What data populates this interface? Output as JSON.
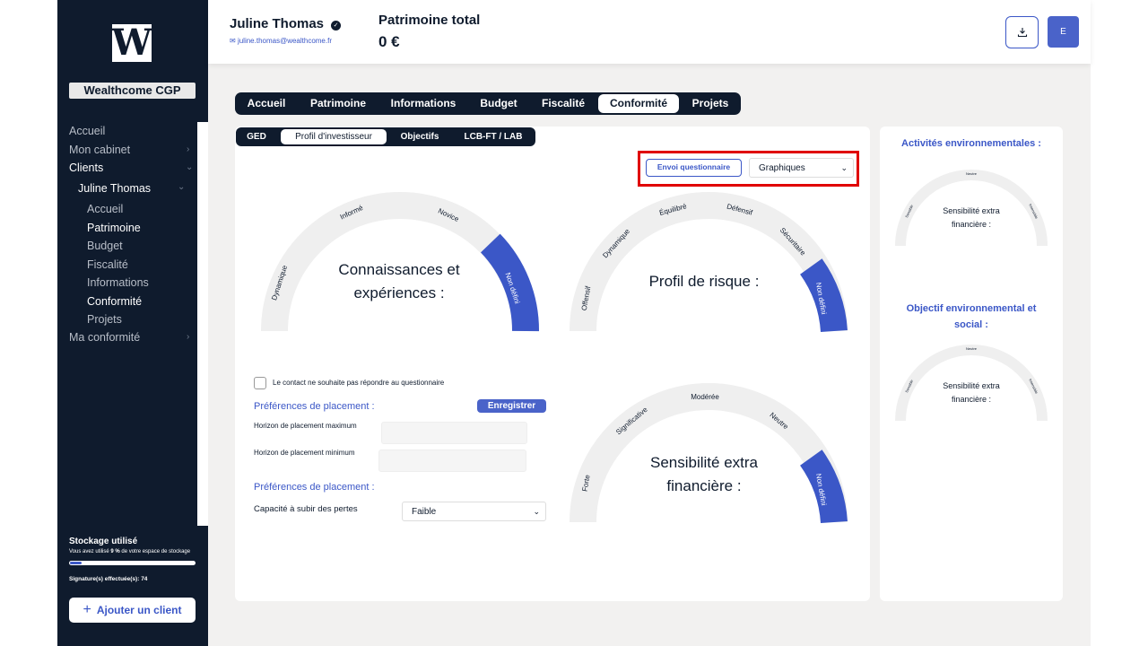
{
  "brand": {
    "logo_letter": "W",
    "name": "Wealthcome CGP"
  },
  "sidebar": {
    "items": [
      {
        "label": "Accueil"
      },
      {
        "label": "Mon cabinet"
      },
      {
        "label": "Clients"
      },
      {
        "label": "Juline Thomas"
      },
      {
        "label": "Accueil"
      },
      {
        "label": "Patrimoine"
      },
      {
        "label": "Budget"
      },
      {
        "label": "Fiscalité"
      },
      {
        "label": "Informations"
      },
      {
        "label": "Conformité"
      },
      {
        "label": "Projets"
      },
      {
        "label": "Ma conformité"
      }
    ],
    "storage_title": "Stockage utilisé",
    "storage_sub_pre": "Vous avez utilisé ",
    "storage_pct": "9 %",
    "storage_sub_post": " de votre espace de stockage",
    "storage_fraction": 0.09,
    "signatures_label": "Signature(s) effectuée(s): ",
    "signatures_count": "74",
    "add_client": "Ajouter un client"
  },
  "header": {
    "client_name": "Juline Thomas",
    "client_email": "juline.thomas@wealthcome.fr",
    "patrimoine_label": "Patrimoine total",
    "patrimoine_value": "0 €",
    "user_initial": "E"
  },
  "tabs": [
    "Accueil",
    "Patrimoine",
    "Informations",
    "Budget",
    "Fiscalité",
    "Conformité",
    "Projets"
  ],
  "active_tab": "Conformité",
  "subtabs": [
    "GED",
    "Profil d'investisseur",
    "Objectifs",
    "LCB-FT / LAB"
  ],
  "active_subtab": "Profil d'investisseur",
  "controls": {
    "envoi": "Envoi questionnaire",
    "view_select": "Graphiques"
  },
  "gauges": {
    "connaissances": {
      "title_l1": "Connaissances et",
      "title_l2": "expériences :",
      "labels": [
        "Dynamique",
        "Informé",
        "Novice",
        "Non défini"
      ]
    },
    "risque": {
      "title": "Profil de risque :",
      "labels": [
        "Offensif",
        "Dynamique",
        "Équilibré",
        "Défensif",
        "Sécuritaire",
        "Non défini"
      ]
    },
    "sensibilite": {
      "title_l1": "Sensibilité extra",
      "title_l2": "financière :",
      "labels": [
        "Forte",
        "Significative",
        "Modérée",
        "Neutre",
        "Non défini"
      ]
    }
  },
  "form": {
    "no_answer": "Le contact ne souhaite pas répondre au questionnaire",
    "pref_head_1": "Préférences de placement :",
    "save": "Enregistrer",
    "horizon_max": "Horizon de placement maximum",
    "horizon_min": "Horizon de placement minimum",
    "pref_head_2": "Préférences de placement :",
    "capacite_label": "Capacité à subir des pertes",
    "capacite_value": "Faible"
  },
  "side": {
    "head_1": "Activités environnementales :",
    "head_2_l1": "Objectif environnemental et",
    "head_2_l2": "social :",
    "gauge_labels": [
      "Sensible",
      "Neutre",
      "Insensible"
    ],
    "gauge_text_l1": "Sensibilité extra",
    "gauge_text_l2": "financière :"
  },
  "colors": {
    "navy": "#0f1b2d",
    "accent": "#3b57c7",
    "highlight": "#e00000"
  }
}
